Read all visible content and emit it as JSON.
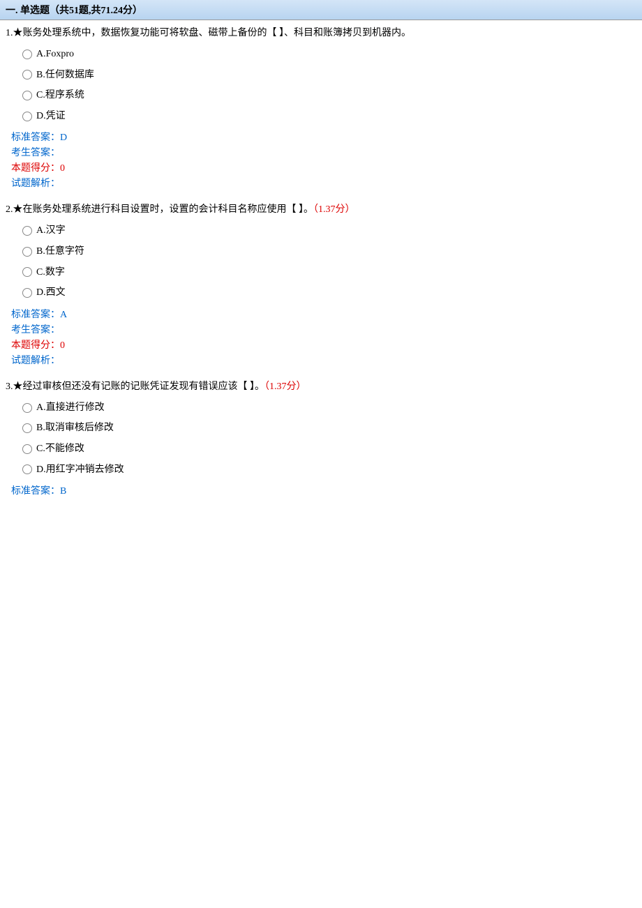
{
  "section": {
    "title": "一. 单选题（共51题,共71.24分）"
  },
  "labels": {
    "standard_answer": "标准答案：",
    "student_answer": "考生答案：",
    "score": "本题得分：",
    "analysis": "试题解析："
  },
  "questions": [
    {
      "number": "1.",
      "star": "★",
      "text": "账务处理系统中，数据恢复功能可将软盘、磁带上备份的【  】、科目和账簿拷贝到机器内。",
      "points": "",
      "options": [
        {
          "label": "A.Foxpro"
        },
        {
          "label": "B.任何数据库"
        },
        {
          "label": "C.程序系统"
        },
        {
          "label": "D.凭证"
        }
      ],
      "standard_answer": "D",
      "student_answer": "",
      "score": "0",
      "analysis": ""
    },
    {
      "number": "2.",
      "star": "★",
      "text": "在账务处理系统进行科目设置时，设置的会计科目名称应使用【  】。",
      "points": "（1.37分）",
      "options": [
        {
          "label": "A.汉字"
        },
        {
          "label": "B.任意字符"
        },
        {
          "label": "C.数字"
        },
        {
          "label": "D.西文"
        }
      ],
      "standard_answer": "A",
      "student_answer": "",
      "score": "0",
      "analysis": ""
    },
    {
      "number": "3.",
      "star": "★",
      "text": "经过审核但还没有记账的记账凭证发现有错误应该【  】。",
      "points": "（1.37分）",
      "options": [
        {
          "label": "A.直接进行修改"
        },
        {
          "label": "B.取消审核后修改"
        },
        {
          "label": "C.不能修改"
        },
        {
          "label": "D.用红字冲销去修改"
        }
      ],
      "standard_answer": "B",
      "student_answer": "",
      "score": "",
      "analysis": ""
    }
  ]
}
